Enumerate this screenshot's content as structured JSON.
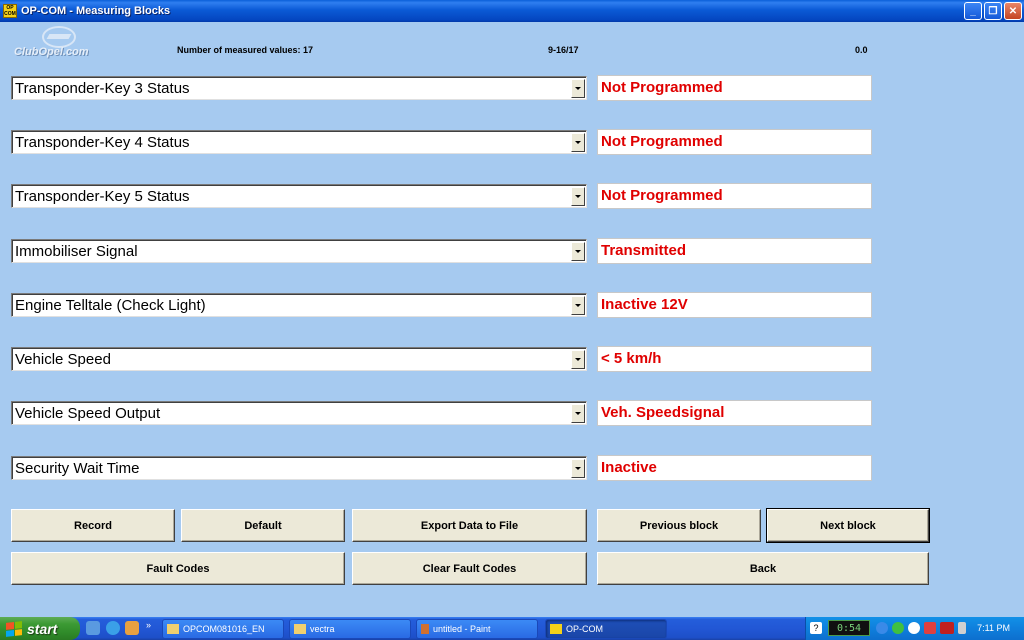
{
  "window": {
    "title": "OP-COM - Measuring Blocks",
    "icon_text": [
      "OP",
      "COM"
    ],
    "buttons": [
      "minimize",
      "maximize",
      "close"
    ]
  },
  "header": {
    "logo_text": "ClubOpel.com",
    "measured_values": "Number of measured values: 17",
    "range": "9-16/17",
    "value": "0.0"
  },
  "rows": [
    {
      "label": "Transponder-Key 3 Status",
      "value": "Not Programmed"
    },
    {
      "label": "Transponder-Key 4 Status",
      "value": "Not Programmed"
    },
    {
      "label": "Transponder-Key 5 Status",
      "value": "Not Programmed"
    },
    {
      "label": "Immobiliser Signal",
      "value": "Transmitted"
    },
    {
      "label": "Engine Telltale (Check Light)",
      "value": "Inactive 12V"
    },
    {
      "label": "Vehicle Speed",
      "value": "< 5 km/h"
    },
    {
      "label": "Vehicle Speed Output",
      "value": "Veh. Speedsignal"
    },
    {
      "label": "Security Wait Time",
      "value": "Inactive"
    }
  ],
  "buttons": {
    "record": "Record",
    "default": "Default",
    "export": "Export Data to File",
    "previous": "Previous block",
    "next": "Next block",
    "fault_codes": "Fault Codes",
    "clear_fault_codes": "Clear Fault Codes",
    "back": "Back"
  },
  "taskbar": {
    "start": "start",
    "tasks": [
      "OPCOM081016_EN",
      "vectra",
      "untitled - Paint",
      "OP-COM"
    ],
    "tray_counter": "0:54",
    "time": "7:11 PM"
  },
  "colors": {
    "background": "#a6caf0",
    "value_text": "#e00000",
    "button_face": "#ece9d8"
  }
}
